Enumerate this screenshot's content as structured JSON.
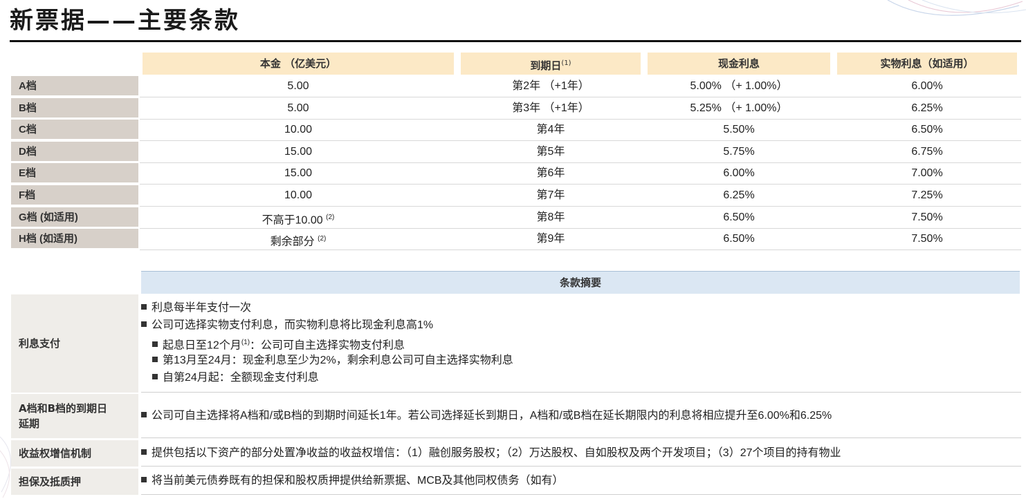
{
  "title": "新票据——主要条款",
  "terms_table": {
    "headers": {
      "principal": "本金 （亿美元）",
      "maturity": "到期日",
      "maturity_note": "(1)",
      "cash_interest": "现金利息",
      "pik_interest": "实物利息（如适用）"
    },
    "rows": [
      {
        "tranche": "A档",
        "principal": "5.00",
        "principal_note": "",
        "maturity": "第2年 （+1年）",
        "cash": "5.00%  （+ 1.00%）",
        "pik": "6.00%"
      },
      {
        "tranche": "B档",
        "principal": "5.00",
        "principal_note": "",
        "maturity": "第3年 （+1年）",
        "cash": "5.25%  （+ 1.00%）",
        "pik": "6.25%"
      },
      {
        "tranche": "C档",
        "principal": "10.00",
        "principal_note": "",
        "maturity": "第4年",
        "cash": "5.50%",
        "pik": "6.50%"
      },
      {
        "tranche": "D档",
        "principal": "15.00",
        "principal_note": "",
        "maturity": "第5年",
        "cash": "5.75%",
        "pik": "6.75%"
      },
      {
        "tranche": "E档",
        "principal": "15.00",
        "principal_note": "",
        "maturity": "第6年",
        "cash": "6.00%",
        "pik": "7.00%"
      },
      {
        "tranche": "F档",
        "principal": "10.00",
        "principal_note": "",
        "maturity": "第7年",
        "cash": "6.25%",
        "pik": "7.25%"
      },
      {
        "tranche": "G档 (如适用)",
        "principal": "不高于10.00",
        "principal_note": "(2)",
        "maturity": "第8年",
        "cash": "6.50%",
        "pik": "7.50%"
      },
      {
        "tranche": "H档 (如适用)",
        "principal": "剩余部分",
        "principal_note": "(2)",
        "maturity": "第9年",
        "cash": "6.50%",
        "pik": "7.50%"
      }
    ]
  },
  "summary": {
    "header": "条款摘要",
    "sections": [
      {
        "label": "利息支付",
        "bullets": [
          {
            "text": "利息每半年支付一次",
            "note": "",
            "rest": ""
          },
          {
            "text": "公司可选择实物支付利息，而实物利息将比现金利息高1%",
            "note": "",
            "rest": ""
          },
          {
            "text": "起息日至12个月",
            "note": "(1)",
            "rest": "：公司可自主选择实物支付利息"
          },
          {
            "text": "第13月至24月：现金利息至少为2%，剩余利息公司可自主选择实物利息",
            "note": "",
            "rest": ""
          },
          {
            "text": "自第24月起：全额现金支付利息",
            "note": "",
            "rest": ""
          }
        ]
      },
      {
        "label_line1": "A档和B档的到期日",
        "label_line2": "延期",
        "bullets": [
          {
            "text": "公司可自主选择将A档和/或B档的到期时间延长1年。若公司选择延长到期日，A档和/或B档在延长期限内的利息将相应提升至6.00%和6.25%"
          }
        ]
      },
      {
        "label": "收益权增信机制",
        "bullets": [
          {
            "text": "提供包括以下资产的部分处置净收益的收益权增信：（1）融创服务股权；（2）万达股权、自如股权及两个开发项目；（3）27个项目的持有物业"
          }
        ]
      },
      {
        "label": "担保及抵质押",
        "bullets": [
          {
            "text": "将当前美元债券既有的担保和股权质押提供给新票据、MCB及其他同权债务（如有）"
          }
        ]
      }
    ]
  }
}
